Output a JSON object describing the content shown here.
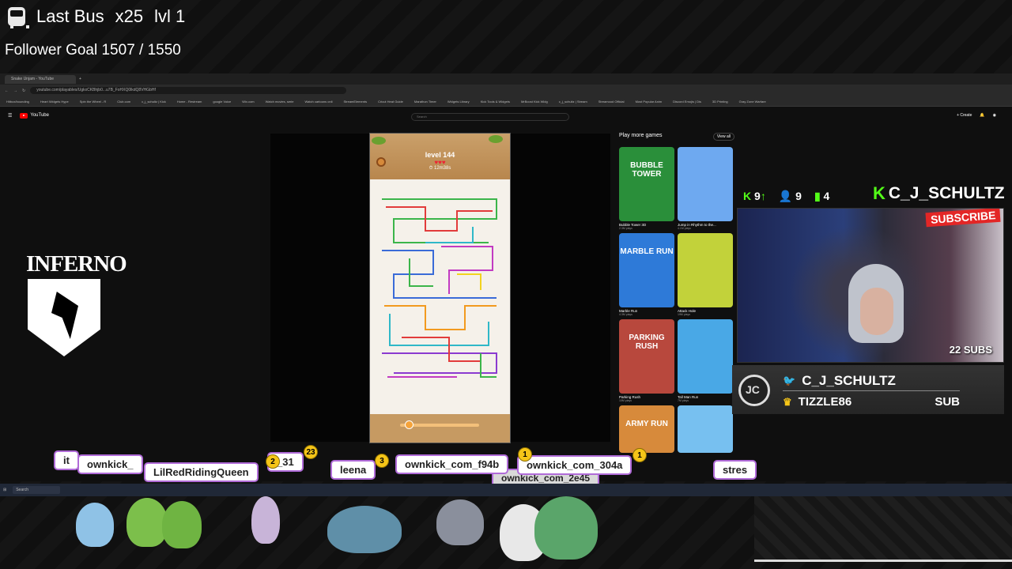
{
  "overlay": {
    "bus_title": "Last Bus",
    "multiplier": "x25",
    "level": "lvl 1",
    "follower_goal": "Follower Goal 1507 / 1550"
  },
  "browser": {
    "tab_title": "Snake Unjam - YouTube",
    "url": "youtube.com/playables/UgkxCKBhjb0...u7B_FoHXQ0lkdQ8VHGbHf",
    "bookmarks": [
      "Hitbox/bounding",
      "Heart Widgets Hype",
      "Spin the Wheel - R",
      "Club.com",
      "c_j_schultz | Kick",
      "Home - Restream",
      "google Voice",
      "Wix.com",
      "Watch movies, serie",
      "Watch cartoons onli",
      "StreamElements",
      "Cricut Heat Guide",
      "Marathon Timer",
      "Widgets Library",
      "Kick Tools & Widgets",
      "MrBoost Kick Widg",
      "c_j_schultz | Stream",
      "Streamood Official",
      "Most Popular Anim",
      "Discord Emojis | Dis",
      "3D Printing",
      "Gray Zone Warfare"
    ]
  },
  "youtube": {
    "logo_text": "YouTube",
    "search_placeholder": "Search",
    "create_label": "Create"
  },
  "game": {
    "level_label": "level 144",
    "hearts": "♥♥♥",
    "timer": "⏱ 12m38s"
  },
  "more_games": {
    "heading": "Play more games",
    "view_all": "View all",
    "items": [
      {
        "thumb_text": "BUBBLE TOWER",
        "title": "Bubble Tower 3D",
        "stats": "2.3M plays",
        "color": "#2a8f3a"
      },
      {
        "thumb_text": "",
        "title": "Jump in Rhythm to the...",
        "stats": "4.1M plays",
        "color": "#6ea9f0"
      },
      {
        "thumb_text": "MARBLE RUN",
        "title": "Marble Run",
        "stats": "4.3M plays",
        "color": "#2e7ad8"
      },
      {
        "thumb_text": "",
        "title": "Attack Hole",
        "stats": "19M plays",
        "color": "#c2d23a"
      },
      {
        "thumb_text": "PARKING RUSH",
        "title": "Parking Rush",
        "stats": "10M plays",
        "color": "#b8483d"
      },
      {
        "thumb_text": "",
        "title": "Tall Man Run",
        "stats": "7M plays",
        "color": "#49a8e6"
      },
      {
        "thumb_text": "ARMY RUN",
        "title": "",
        "stats": "",
        "color": "#d78a3b"
      },
      {
        "thumb_text": "",
        "title": "",
        "stats": "",
        "color": "#77c0f0"
      }
    ]
  },
  "stream": {
    "kick_followers": "9",
    "kick_viewers": "9",
    "kick_chatters": "4",
    "channel_name": "C_J_SCHULTZ",
    "subscribe_sign": "SUBSCRIBE",
    "subs_count": "22 SUBS",
    "twitter_handle": "C_J_SCHULTZ",
    "latest_sub": "TIZZLE86",
    "sub_label": "SUB",
    "team_logo": "INFERNO"
  },
  "chat_tags": [
    {
      "name": "it",
      "badge": ""
    },
    {
      "name": "ownkick_",
      "badge": ""
    },
    {
      "name": "LilRedRidingQueen",
      "badge": "2"
    },
    {
      "name": "_31",
      "badge": "23"
    },
    {
      "name": "leena",
      "badge": "3"
    },
    {
      "name": "ownkick_com_f94b",
      "badge": "1"
    },
    {
      "name": "ownkick_com_304a",
      "badge": "1"
    },
    {
      "name": "ownkick_com_2e45",
      "badge": ""
    },
    {
      "name": "stres",
      "badge": ""
    }
  ],
  "taskbar": {
    "search_label": "Search"
  }
}
